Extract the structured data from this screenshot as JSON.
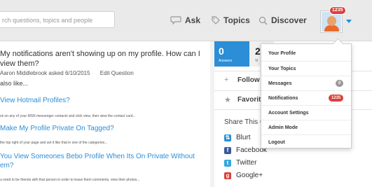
{
  "header": {
    "search_placeholder": "rch questions, topics and people",
    "nav": [
      {
        "label": "Ask",
        "icon": "speech-bubble-icon"
      },
      {
        "label": "Topics",
        "icon": "tag-icon"
      },
      {
        "label": "Discover",
        "icon": "magnifier-icon"
      }
    ],
    "avatar_badge": "1235",
    "accent": "#1e90d6"
  },
  "question": {
    "title": "My notifications aren't showing up on my profile. How can I view them?",
    "author": "Aaron Middlebrook",
    "asked_text": "asked 6/10/2015",
    "edit_label": "Edit Question",
    "also_like": "also like..."
  },
  "related": [
    {
      "title": "View Hotmail Profiles?",
      "snippet": "ck on any of your MSN messenger contacts and click view, then view the contact card..."
    },
    {
      "title": "Make My Profile Private On Tagged?",
      "snippet": "the top right of your page and set it like that in one of the categories..."
    },
    {
      "title": "You View Someones Bebo Profile When Its On Private Without",
      "title_line2": "em?",
      "snippet": "u need to be friends with that person in order to leave them comments, view their photos..."
    }
  ],
  "sidebar": {
    "stats": [
      {
        "num": "0",
        "label": "Answers"
      },
      {
        "num": "2",
        "label": "Vi"
      }
    ],
    "follow_label": "Follow Q",
    "favorite_label": "Favorite",
    "share_title": "Share This Q",
    "share": [
      {
        "label": "Blurt",
        "color": "#2b8ed6"
      },
      {
        "label": "Facebook",
        "color": "#3b5998"
      },
      {
        "label": "Twitter",
        "color": "#2fa8e0"
      },
      {
        "label": "Google+",
        "color": "#d9403a"
      }
    ]
  },
  "dropdown": {
    "items": [
      {
        "label": "Your Profile"
      },
      {
        "label": "Your Topics"
      },
      {
        "label": "Messages",
        "badge": "0"
      },
      {
        "label": "Notifications",
        "badge": "1235"
      },
      {
        "label": "Account Settings"
      },
      {
        "label": "Admin Mode"
      },
      {
        "label": "Logout"
      }
    ]
  }
}
